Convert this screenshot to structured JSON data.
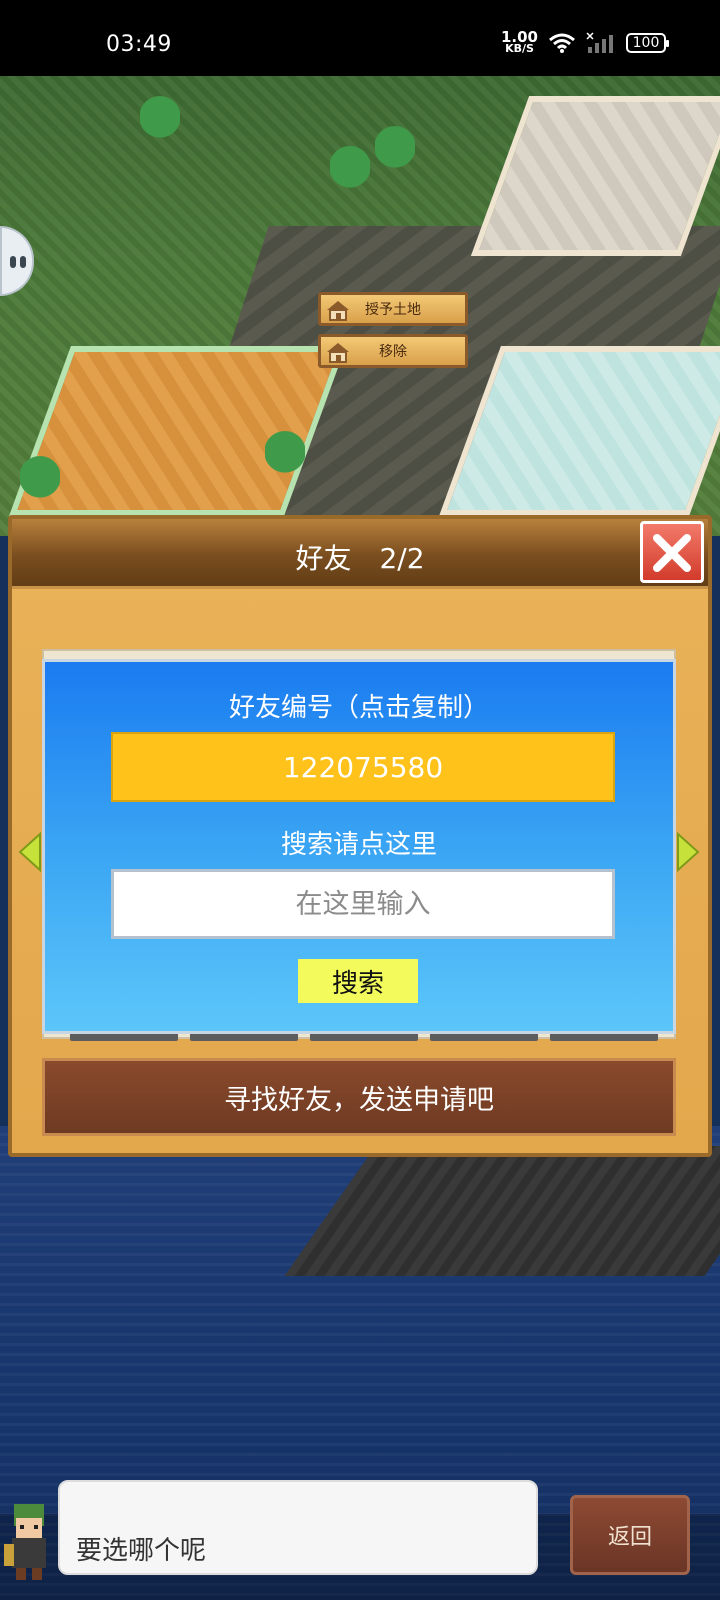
{
  "status_bar": {
    "time": "03:49",
    "net_speed_value": "1.00",
    "net_speed_unit": "KB/S",
    "battery": "100",
    "icons": [
      "wifi-icon",
      "signal-icon",
      "battery-icon"
    ]
  },
  "scene": {
    "context_menu": {
      "grant_land_label": "授予土地",
      "remove_label": "移除"
    }
  },
  "dialog": {
    "title": "好友　2/2",
    "friend_id_label": "好友编号（点击复制）",
    "friend_id_value": "122075580",
    "search_label": "搜索请点这里",
    "search_placeholder": "在这里输入",
    "search_button": "搜索",
    "send_request_label": "寻找好友，发送申请吧"
  },
  "chat": {
    "message": "要选哪个呢"
  },
  "back_button": "返回",
  "colors": {
    "panel_top": "#1a7cf0",
    "panel_bottom": "#5cc6fa",
    "id_box": "#ffc21a",
    "search_button": "#f2fa5c",
    "close_button": "#d23b2b",
    "dialog_frame": "#e3a74c"
  }
}
